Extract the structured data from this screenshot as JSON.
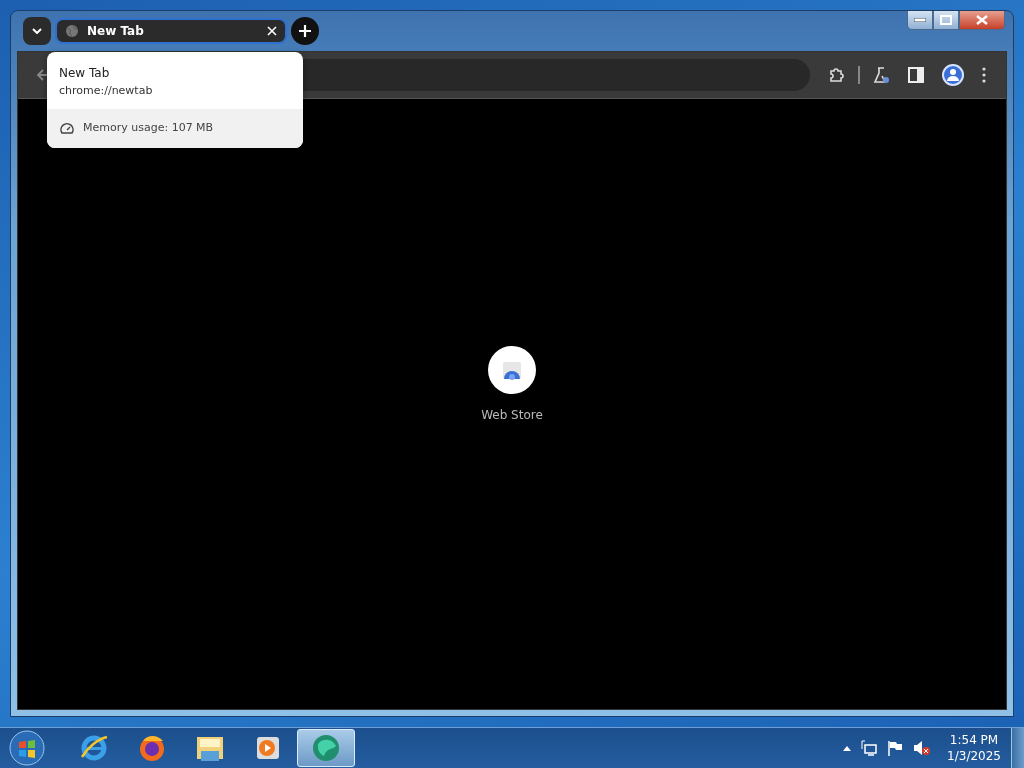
{
  "tab": {
    "title": "New Tab",
    "selected": true
  },
  "hover_card": {
    "title": "New Tab",
    "url": "chrome://newtab",
    "memory": "Memory usage: 107 MB"
  },
  "shortcut": {
    "label": "Web Store"
  },
  "taskbar": {
    "items": [
      {
        "kind": "ie",
        "selected": false
      },
      {
        "kind": "firefox",
        "selected": false
      },
      {
        "kind": "explorer",
        "selected": false
      },
      {
        "kind": "media",
        "selected": false
      },
      {
        "kind": "chrome",
        "selected": true
      }
    ],
    "time": "1:54 PM",
    "date": "1/3/2025"
  }
}
